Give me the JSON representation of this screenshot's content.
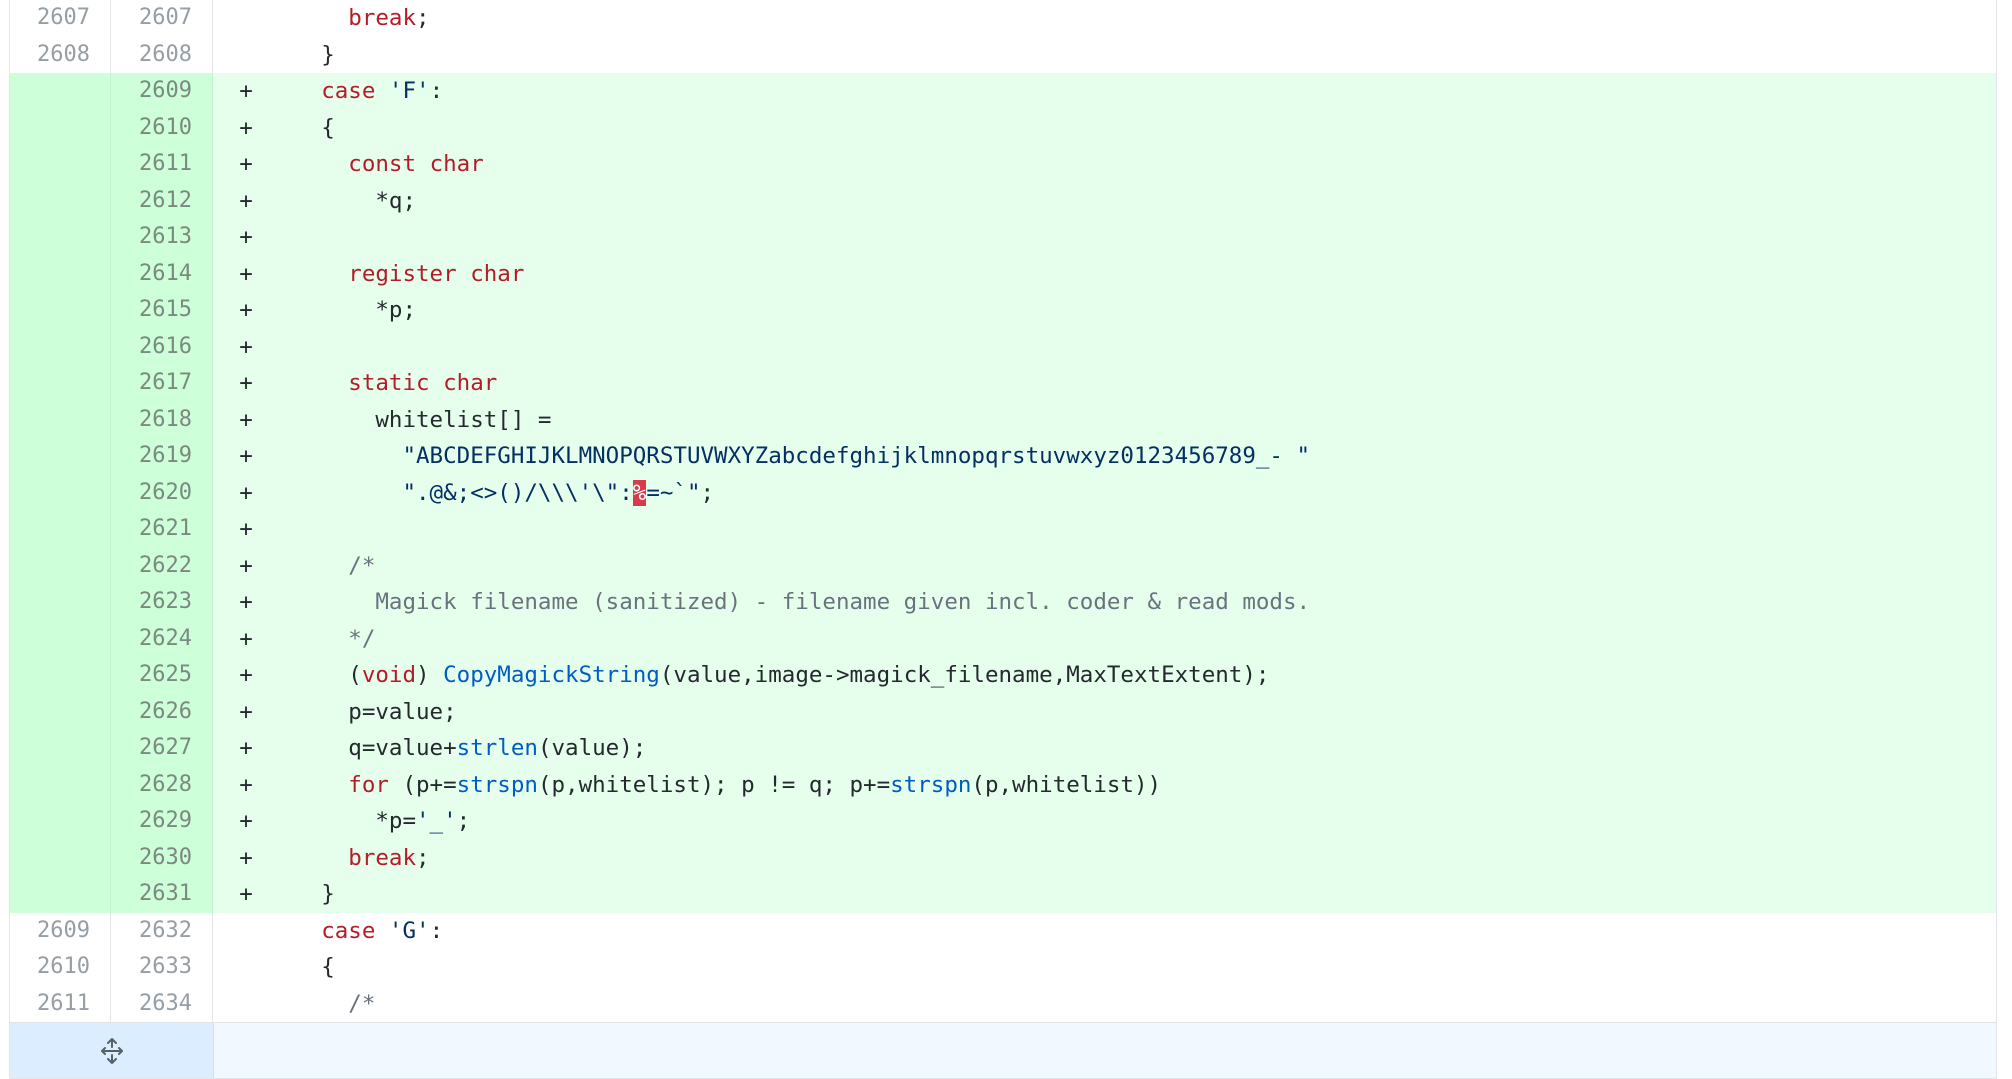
{
  "diff": {
    "rows": [
      {
        "type": "ctx",
        "old": "2607",
        "new": "2607",
        "marker": "",
        "indent": "      ",
        "tokens": [
          {
            "t": "break",
            "c": "kw2"
          },
          {
            "t": ";",
            "c": "ws"
          }
        ]
      },
      {
        "type": "ctx",
        "old": "2608",
        "new": "2608",
        "marker": "",
        "indent": "    ",
        "tokens": [
          {
            "t": "}",
            "c": "ws"
          }
        ]
      },
      {
        "type": "add",
        "old": "",
        "new": "2609",
        "marker": "+",
        "indent": "    ",
        "tokens": [
          {
            "t": "case",
            "c": "kw2"
          },
          {
            "t": " ",
            "c": "ws"
          },
          {
            "t": "'F'",
            "c": "str"
          },
          {
            "t": ":",
            "c": "ws"
          }
        ]
      },
      {
        "type": "add",
        "old": "",
        "new": "2610",
        "marker": "+",
        "indent": "    ",
        "tokens": [
          {
            "t": "{",
            "c": "ws"
          }
        ]
      },
      {
        "type": "add",
        "old": "",
        "new": "2611",
        "marker": "+",
        "indent": "      ",
        "tokens": [
          {
            "t": "const",
            "c": "kw2"
          },
          {
            "t": " ",
            "c": "ws"
          },
          {
            "t": "char",
            "c": "kw2"
          }
        ]
      },
      {
        "type": "add",
        "old": "",
        "new": "2612",
        "marker": "+",
        "indent": "        ",
        "tokens": [
          {
            "t": "*q;",
            "c": "ws"
          }
        ]
      },
      {
        "type": "add",
        "old": "",
        "new": "2613",
        "marker": "+",
        "indent": "",
        "tokens": []
      },
      {
        "type": "add",
        "old": "",
        "new": "2614",
        "marker": "+",
        "indent": "      ",
        "tokens": [
          {
            "t": "register",
            "c": "kw2"
          },
          {
            "t": " ",
            "c": "ws"
          },
          {
            "t": "char",
            "c": "kw2"
          }
        ]
      },
      {
        "type": "add",
        "old": "",
        "new": "2615",
        "marker": "+",
        "indent": "        ",
        "tokens": [
          {
            "t": "*p;",
            "c": "ws"
          }
        ]
      },
      {
        "type": "add",
        "old": "",
        "new": "2616",
        "marker": "+",
        "indent": "",
        "tokens": []
      },
      {
        "type": "add",
        "old": "",
        "new": "2617",
        "marker": "+",
        "indent": "      ",
        "tokens": [
          {
            "t": "static",
            "c": "kw2"
          },
          {
            "t": " ",
            "c": "ws"
          },
          {
            "t": "char",
            "c": "kw2"
          }
        ]
      },
      {
        "type": "add",
        "old": "",
        "new": "2618",
        "marker": "+",
        "indent": "        ",
        "tokens": [
          {
            "t": "whitelist[] =",
            "c": "ws"
          }
        ]
      },
      {
        "type": "add",
        "old": "",
        "new": "2619",
        "marker": "+",
        "indent": "          ",
        "tokens": [
          {
            "t": "\"ABCDEFGHIJKLMNOPQRSTUVWXYZabcdefghijklmnopqrstuvwxyz0123456789_- \"",
            "c": "str"
          }
        ]
      },
      {
        "type": "add",
        "old": "",
        "new": "2620",
        "marker": "+",
        "indent": "          ",
        "tokens": [
          {
            "t": "\".@&;<>()/\\\\\\'\\\":",
            "c": "str"
          },
          {
            "t": "%",
            "c": "bad"
          },
          {
            "t": "=~`\"",
            "c": "str"
          },
          {
            "t": ";",
            "c": "ws"
          }
        ]
      },
      {
        "type": "add",
        "old": "",
        "new": "2621",
        "marker": "+",
        "indent": "",
        "tokens": []
      },
      {
        "type": "add",
        "old": "",
        "new": "2622",
        "marker": "+",
        "indent": "      ",
        "tokens": [
          {
            "t": "/*",
            "c": "com"
          }
        ]
      },
      {
        "type": "add",
        "old": "",
        "new": "2623",
        "marker": "+",
        "indent": "        ",
        "tokens": [
          {
            "t": "Magick filename (sanitized) - filename given incl. coder & read mods.",
            "c": "com"
          }
        ]
      },
      {
        "type": "add",
        "old": "",
        "new": "2624",
        "marker": "+",
        "indent": "      ",
        "tokens": [
          {
            "t": "*/",
            "c": "com"
          }
        ]
      },
      {
        "type": "add",
        "old": "",
        "new": "2625",
        "marker": "+",
        "indent": "      ",
        "tokens": [
          {
            "t": "(",
            "c": "ws"
          },
          {
            "t": "void",
            "c": "kw2"
          },
          {
            "t": ") ",
            "c": "ws"
          },
          {
            "t": "CopyMagickString",
            "c": "fn"
          },
          {
            "t": "(value,image->magick_filename,MaxTextExtent);",
            "c": "ws"
          }
        ]
      },
      {
        "type": "add",
        "old": "",
        "new": "2626",
        "marker": "+",
        "indent": "      ",
        "tokens": [
          {
            "t": "p=value;",
            "c": "ws"
          }
        ]
      },
      {
        "type": "add",
        "old": "",
        "new": "2627",
        "marker": "+",
        "indent": "      ",
        "tokens": [
          {
            "t": "q=value+",
            "c": "ws"
          },
          {
            "t": "strlen",
            "c": "fn"
          },
          {
            "t": "(value);",
            "c": "ws"
          }
        ]
      },
      {
        "type": "add",
        "old": "",
        "new": "2628",
        "marker": "+",
        "indent": "      ",
        "tokens": [
          {
            "t": "for",
            "c": "kw2"
          },
          {
            "t": " (p+=",
            "c": "ws"
          },
          {
            "t": "strspn",
            "c": "fn"
          },
          {
            "t": "(p,whitelist); p != q; p+=",
            "c": "ws"
          },
          {
            "t": "strspn",
            "c": "fn"
          },
          {
            "t": "(p,whitelist))",
            "c": "ws"
          }
        ]
      },
      {
        "type": "add",
        "old": "",
        "new": "2629",
        "marker": "+",
        "indent": "        ",
        "tokens": [
          {
            "t": "*p=",
            "c": "ws"
          },
          {
            "t": "'_'",
            "c": "str"
          },
          {
            "t": ";",
            "c": "ws"
          }
        ]
      },
      {
        "type": "add",
        "old": "",
        "new": "2630",
        "marker": "+",
        "indent": "      ",
        "tokens": [
          {
            "t": "break",
            "c": "kw2"
          },
          {
            "t": ";",
            "c": "ws"
          }
        ]
      },
      {
        "type": "add",
        "old": "",
        "new": "2631",
        "marker": "+",
        "indent": "    ",
        "tokens": [
          {
            "t": "}",
            "c": "ws"
          }
        ]
      },
      {
        "type": "ctx",
        "old": "2609",
        "new": "2632",
        "marker": "",
        "indent": "    ",
        "tokens": [
          {
            "t": "case",
            "c": "kw2"
          },
          {
            "t": " ",
            "c": "ws"
          },
          {
            "t": "'G'",
            "c": "str"
          },
          {
            "t": ":",
            "c": "ws"
          }
        ]
      },
      {
        "type": "ctx",
        "old": "2610",
        "new": "2633",
        "marker": "",
        "indent": "    ",
        "tokens": [
          {
            "t": "{",
            "c": "ws"
          }
        ]
      },
      {
        "type": "ctx",
        "old": "2611",
        "new": "2634",
        "marker": "",
        "indent": "      ",
        "tokens": [
          {
            "t": "/*",
            "c": "com"
          }
        ]
      }
    ],
    "expand_icon": "expand-icon"
  },
  "colors": {
    "addition_bg": "#e6ffed",
    "addition_gutter_bg": "#cdffd8",
    "keyword": "#b31d28",
    "string": "#032f62",
    "function": "#005cc5",
    "comment": "#6a737d",
    "error_highlight": "#d73a49",
    "expander_bg": "#dbedff"
  }
}
